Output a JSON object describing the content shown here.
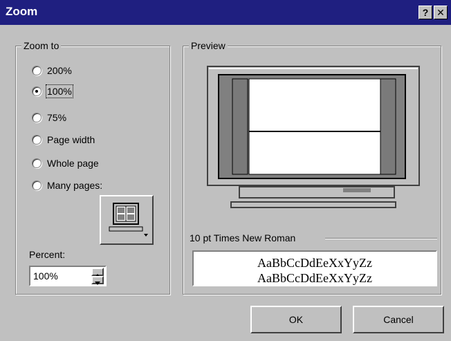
{
  "window": {
    "title": "Zoom",
    "help_label": "?",
    "close_label": "✕"
  },
  "zoom_to": {
    "label": "Zoom to",
    "options": [
      {
        "label": "200%",
        "checked": false
      },
      {
        "label": "100%",
        "checked": true
      },
      {
        "label": "75%",
        "checked": false
      },
      {
        "label": "Page width",
        "checked": false
      },
      {
        "label": "Whole page",
        "checked": false
      },
      {
        "label": "Many pages:",
        "checked": false
      }
    ]
  },
  "percent": {
    "label": "Percent:",
    "value": "100%"
  },
  "preview": {
    "label": "Preview",
    "font_label": "10 pt Times New Roman",
    "sample_line1": "AaBbCcDdEeXxYyZz",
    "sample_line2": "AaBbCcDdEeXxYyZz"
  },
  "buttons": {
    "ok_label": "OK",
    "cancel_label": "Cancel"
  }
}
